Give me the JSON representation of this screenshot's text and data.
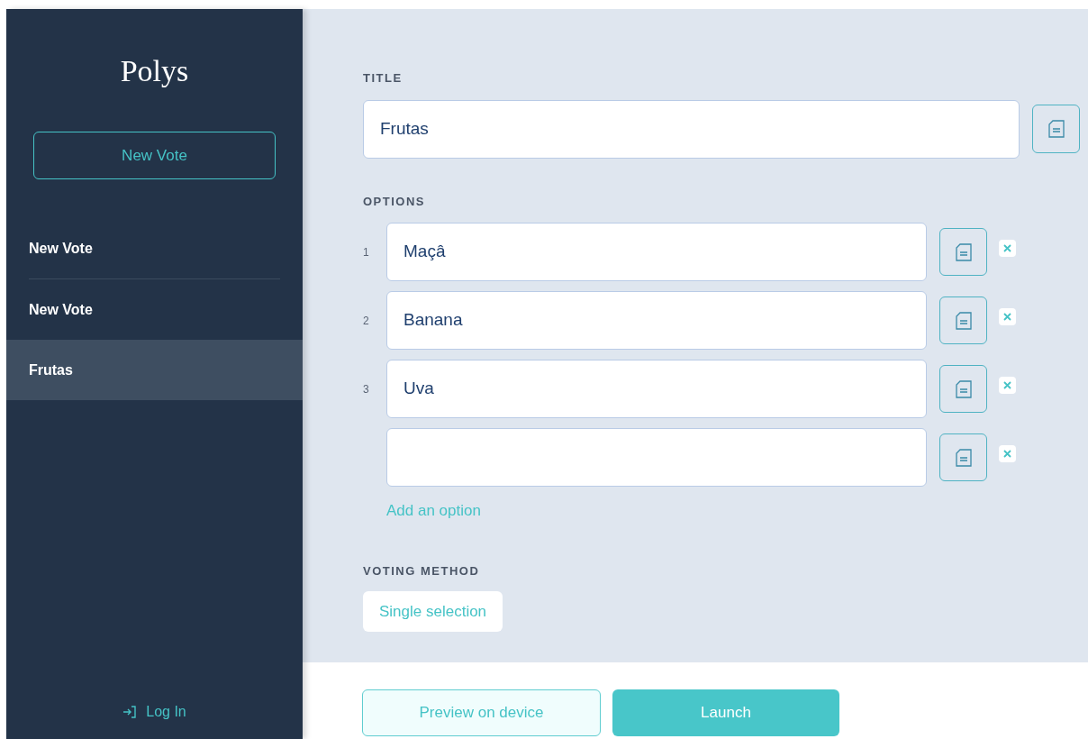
{
  "sidebar": {
    "logo": "Polys",
    "new_button": "New Vote",
    "items": [
      {
        "label": "New Vote",
        "selected": false
      },
      {
        "label": "New Vote",
        "selected": false
      },
      {
        "label": "Frutas",
        "selected": true
      }
    ],
    "login": "Log In"
  },
  "form": {
    "title_label": "TITLE",
    "title_value": "Frutas",
    "options_label": "OPTIONS",
    "options": [
      {
        "number": "1",
        "value": "Maçâ"
      },
      {
        "number": "2",
        "value": "Banana"
      },
      {
        "number": "3",
        "value": "Uva"
      }
    ],
    "add_option": "Add an option",
    "voting_label": "VOTING METHOD",
    "voting_method": "Single selection"
  },
  "footer": {
    "preview": "Preview on device",
    "launch": "Launch"
  }
}
